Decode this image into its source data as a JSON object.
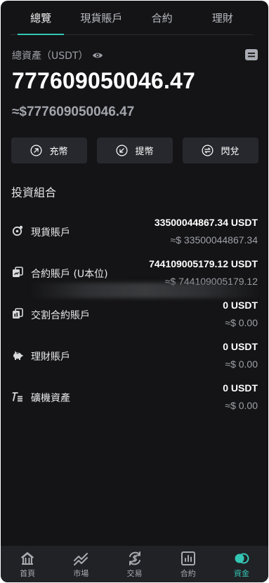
{
  "tabs": [
    {
      "label": "總覽",
      "active": true
    },
    {
      "label": "現貨賬戶",
      "active": false
    },
    {
      "label": "合約",
      "active": false
    },
    {
      "label": "理財",
      "active": false
    }
  ],
  "summary": {
    "label": "總資產（USDT）",
    "total": "777609050046.47",
    "approx": "≈$777609050046.47"
  },
  "actions": {
    "deposit": "充幣",
    "withdraw": "提幣",
    "convert": "閃兌"
  },
  "portfolio": {
    "title": "投資組合",
    "items": [
      {
        "name": "現貨賬戶",
        "icon": "spot-account-icon",
        "amount": "33500044867.34 USDT",
        "approx": "≈$ 33500044867.34"
      },
      {
        "name": "合約賬戶 (U本位)",
        "icon": "futures-account-icon",
        "amount": "744109005179.12 USDT",
        "approx": "≈$ 744109005179.12"
      },
      {
        "name": "交割合約賬戶",
        "icon": "delivery-account-icon",
        "amount": "0 USDT",
        "approx": "≈$ 0.00"
      },
      {
        "name": "理財賬戶",
        "icon": "piggy-bank-icon",
        "amount": "0 USDT",
        "approx": "≈$ 0.00"
      },
      {
        "name": "礦機資產",
        "icon": "mining-icon",
        "amount": "0 USDT",
        "approx": "≈$ 0.00"
      }
    ]
  },
  "nav": [
    {
      "label": "首頁",
      "icon": "home-icon",
      "active": false
    },
    {
      "label": "市場",
      "icon": "market-chart-icon",
      "active": false
    },
    {
      "label": "交易",
      "icon": "trade-icon",
      "active": false
    },
    {
      "label": "合約",
      "icon": "contract-icon",
      "active": false
    },
    {
      "label": "資金",
      "icon": "funds-icon",
      "active": true
    }
  ],
  "colors": {
    "background": "#141416",
    "accent": "#34c6b4",
    "button": "#26282d",
    "nav": "#202226"
  }
}
